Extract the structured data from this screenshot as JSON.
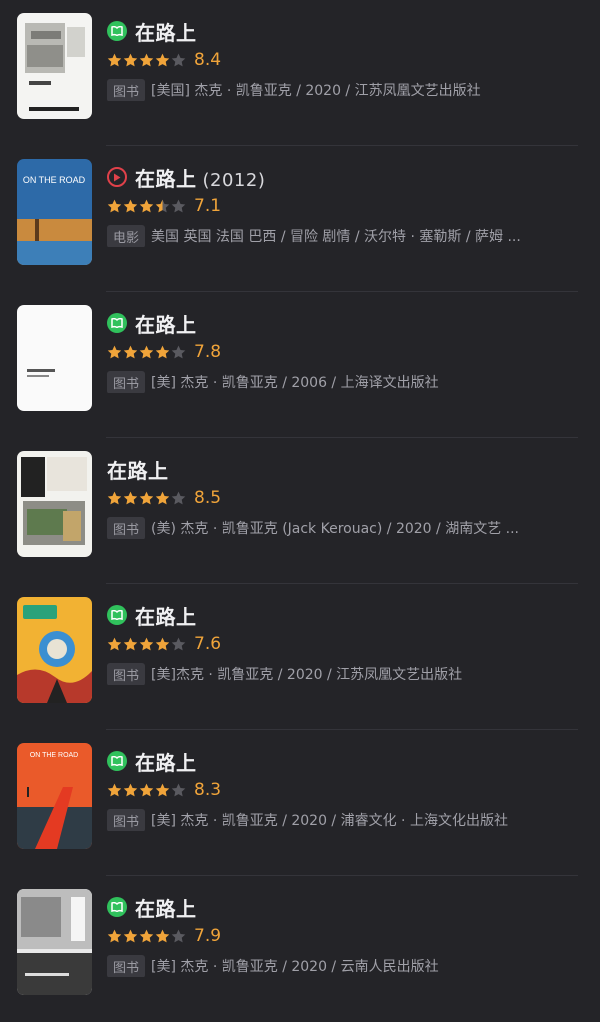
{
  "accent": {
    "book": "#30c15c",
    "movie": "#e0414a",
    "star": "#f0a43a"
  },
  "results": [
    {
      "type": "book",
      "icon": "book-icon",
      "title": "在路上",
      "year": "",
      "stars": 4,
      "score": "8.4",
      "tag": "图书",
      "meta": "[美国] 杰克 · 凯鲁亚克 / 2020 / 江苏凤凰文艺出版社"
    },
    {
      "type": "movie",
      "icon": "play-icon",
      "title": "在路上",
      "year": "(2012)",
      "stars": 3.5,
      "score": "7.1",
      "tag": "电影",
      "meta": "美国 英国 法国 巴西 / 冒险 剧情 / 沃尔特 · 塞勒斯 / 萨姆 ...",
      "cover_text": "ON THE ROAD"
    },
    {
      "type": "book",
      "icon": "book-icon",
      "title": "在路上",
      "year": "",
      "stars": 4,
      "score": "7.8",
      "tag": "图书",
      "meta": "[美] 杰克 · 凯鲁亚克 / 2006 / 上海译文出版社"
    },
    {
      "type": "book",
      "icon": "",
      "title": "在路上",
      "year": "",
      "stars": 4,
      "score": "8.5",
      "tag": "图书",
      "meta": "(美) 杰克 · 凯鲁亚克 (Jack Kerouac) / 2020 / 湖南文艺 ..."
    },
    {
      "type": "book",
      "icon": "book-icon",
      "title": "在路上",
      "year": "",
      "stars": 4,
      "score": "7.6",
      "tag": "图书",
      "meta": "[美]杰克 · 凯鲁亚克 / 2020 / 江苏凤凰文艺出版社"
    },
    {
      "type": "book",
      "icon": "book-icon",
      "title": "在路上",
      "year": "",
      "stars": 4,
      "score": "8.3",
      "tag": "图书",
      "meta": "[美] 杰克 · 凯鲁亚克 / 2020 / 浦睿文化 · 上海文化出版社",
      "cover_text": "ON THE ROAD"
    },
    {
      "type": "book",
      "icon": "book-icon",
      "title": "在路上",
      "year": "",
      "stars": 4,
      "score": "7.9",
      "tag": "图书",
      "meta": "[美] 杰克 · 凯鲁亚克 / 2020 / 云南人民出版社"
    }
  ]
}
